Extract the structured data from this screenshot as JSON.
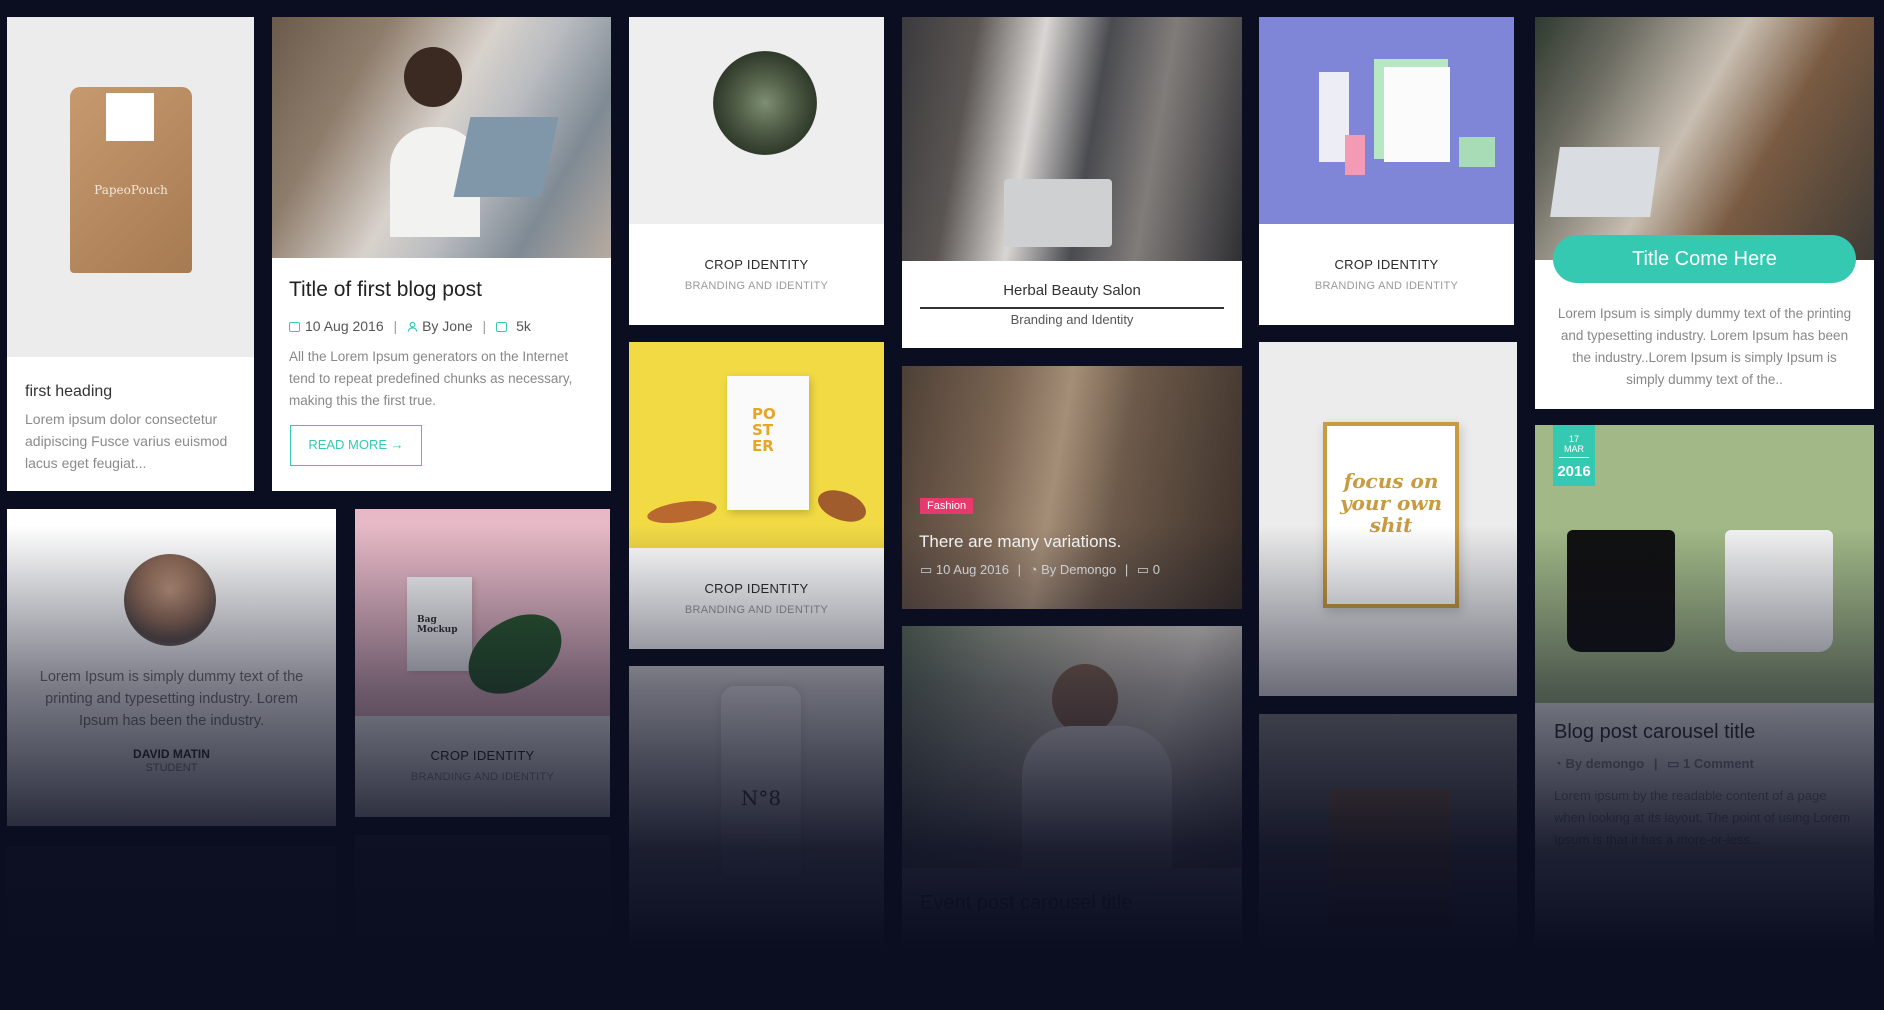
{
  "colors": {
    "background": "#0b0e21",
    "accent": "#36c9b1",
    "fashion_badge": "#e8396f"
  },
  "cards": {
    "pouch": {
      "heading": "first heading",
      "text": "Lorem ipsum dolor consectetur adipiscing Fusce varius euismod lacus eget feugiat...",
      "brand": "PapeoPouch"
    },
    "blog1": {
      "title": "Title of first blog post",
      "date": "10 Aug 2016",
      "author": "By Jone",
      "comments": "5k",
      "excerpt": "All the Lorem Ipsum generators on the Internet tend to repeat predefined chunks as necessary, making this the first true.",
      "read_more": "READ MORE"
    },
    "crop1": {
      "title": "CROP IDENTITY",
      "subtitle": "BRANDING AND IDENTITY"
    },
    "herbal": {
      "title": "Herbal Beauty Salon",
      "subtitle": "Branding and Identity"
    },
    "crop2": {
      "title": "CROP IDENTITY",
      "subtitle": "BRANDING AND IDENTITY"
    },
    "team": {
      "button": "Title Come Here",
      "text": "Lorem Ipsum is simply dummy text of the printing and typesetting industry. Lorem Ipsum has been the industry..Lorem Ipsum is simply Ipsum is simply dummy text of the.."
    },
    "testimonial": {
      "text": "Lorem Ipsum is simply dummy text of the printing and typesetting industry. Lorem Ipsum has been the industry.",
      "name": "DAVID MATIN",
      "role": "STUDENT"
    },
    "bag": {
      "title": "CROP IDENTITY",
      "subtitle": "BRANDING AND IDENTITY",
      "label": "Bag Mockup"
    },
    "poster": {
      "title": "CROP IDENTITY",
      "subtitle": "BRANDING AND IDENTITY"
    },
    "fashion": {
      "badge": "Fashion",
      "title": "There are many variations.",
      "date": "10 Aug 2016",
      "author": "By Demongo",
      "comments": "0"
    },
    "focus": {
      "text": "focus on your own shit"
    },
    "mug": {
      "day": "17 MAR",
      "year": "2016",
      "title": "Blog post carousel title",
      "author": "By demongo",
      "comments": "1 Comment",
      "excerpt": "Lorem ipsum by the readable content of a page when looking at its layout. The point of using Lorem Ipsum is that it has a more-or-less..."
    },
    "bottle": {
      "label": "N°8"
    },
    "event": {
      "title": "Event post carousel title"
    }
  }
}
